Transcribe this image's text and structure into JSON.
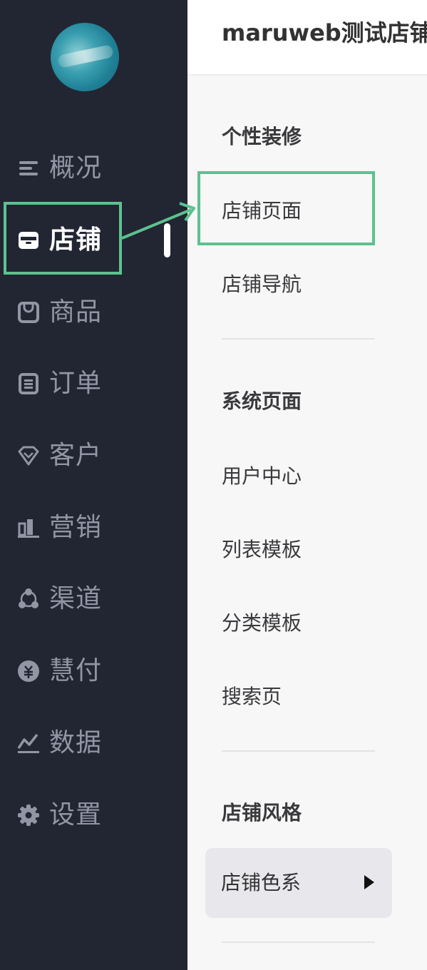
{
  "header": {
    "title": "maruweb测试店铺"
  },
  "sidebar": {
    "items": [
      {
        "label": "概况",
        "icon": "overview-icon"
      },
      {
        "label": "店铺",
        "icon": "store-icon"
      },
      {
        "label": "商品",
        "icon": "goods-icon"
      },
      {
        "label": "订单",
        "icon": "order-icon"
      },
      {
        "label": "客户",
        "icon": "customer-icon"
      },
      {
        "label": "营销",
        "icon": "marketing-icon"
      },
      {
        "label": "渠道",
        "icon": "channel-icon"
      },
      {
        "label": "慧付",
        "icon": "payment-icon"
      },
      {
        "label": "数据",
        "icon": "data-icon"
      },
      {
        "label": "设置",
        "icon": "settings-icon"
      }
    ]
  },
  "subnav": {
    "group1": {
      "title": "个性装修",
      "items": [
        "店铺页面",
        "店铺导航"
      ]
    },
    "group2": {
      "title": "系统页面",
      "items": [
        "用户中心",
        "列表模板",
        "分类模板",
        "搜索页"
      ]
    },
    "group3": {
      "title": "店铺风格",
      "items": [
        "店铺色系"
      ]
    }
  },
  "colors": {
    "sidebar_bg": "#222632",
    "callout": "#5cc28f",
    "inactive_text": "#9196a5"
  }
}
